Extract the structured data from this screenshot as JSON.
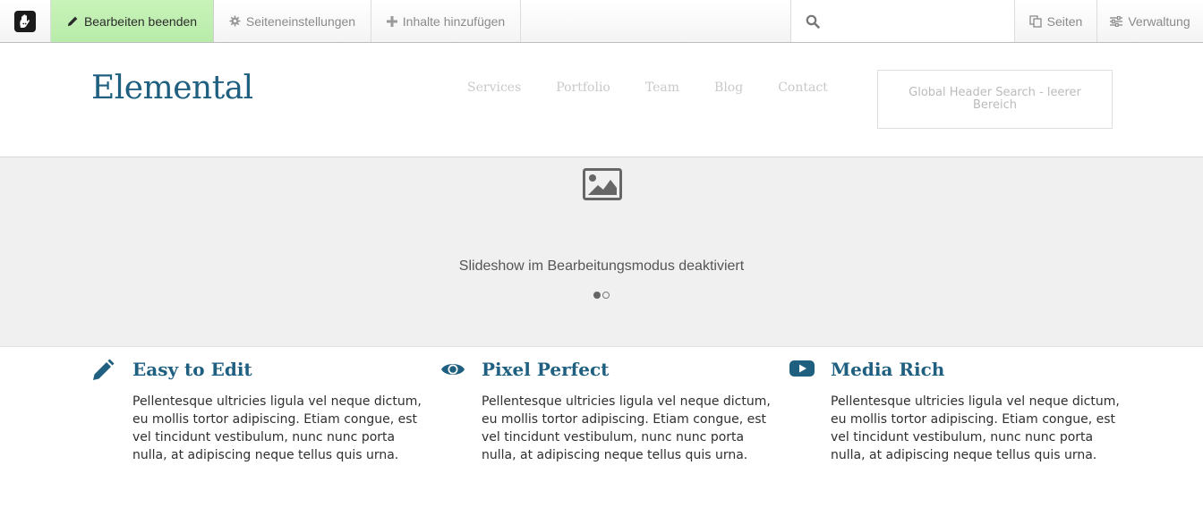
{
  "toolbar": {
    "edit_label": "Bearbeiten beenden",
    "settings_label": "Seiteneinstellungen",
    "add_label": "Inhalte hinzufügen",
    "search_placeholder": "",
    "pages_label": "Seiten",
    "admin_label": "Verwaltung",
    "edit_active_color": "#c4f0b4",
    "icons": {
      "logo": "concrete5-hand-logo",
      "edit": "pencil-icon",
      "settings": "gear-icon",
      "add": "plus-icon",
      "search": "search-icon",
      "pages": "copy-icon",
      "admin": "sliders-icon"
    }
  },
  "header": {
    "brand": "Elemental",
    "nav": [
      "Services",
      "Portfolio",
      "Team",
      "Blog",
      "Contact"
    ],
    "search_area_text": "Global Header Search - leerer Bereich"
  },
  "slideshow": {
    "message": "Slideshow im Bearbeitungsmodus deaktiviert",
    "icon": "image-icon",
    "dots": 2,
    "active_dot": 1
  },
  "features": [
    {
      "icon": "pencil-icon",
      "title": "Easy to Edit",
      "text": "Pellentesque ultricies ligula vel neque dictum, eu mollis tortor adipiscing. Etiam congue, est vel tincidunt vestibulum, nunc nunc porta nulla, at adipiscing neque tellus quis urna."
    },
    {
      "icon": "eye-icon",
      "title": "Pixel Perfect",
      "text": "Pellentesque ultricies ligula vel neque dictum, eu mollis tortor adipiscing. Etiam congue, est vel tincidunt vestibulum, nunc nunc porta nulla, at adipiscing neque tellus quis urna."
    },
    {
      "icon": "video-play-icon",
      "title": "Media Rich",
      "text": "Pellentesque ultricies ligula vel neque dictum, eu mollis tortor adipiscing. Etiam congue, est vel tincidunt vestibulum, nunc nunc porta nulla, at adipiscing neque tellus quis urna."
    }
  ],
  "colors": {
    "brand": "#1f5f80",
    "edit_active": "#c4f0b4",
    "slideshow_bg": "#f0f0f0"
  }
}
